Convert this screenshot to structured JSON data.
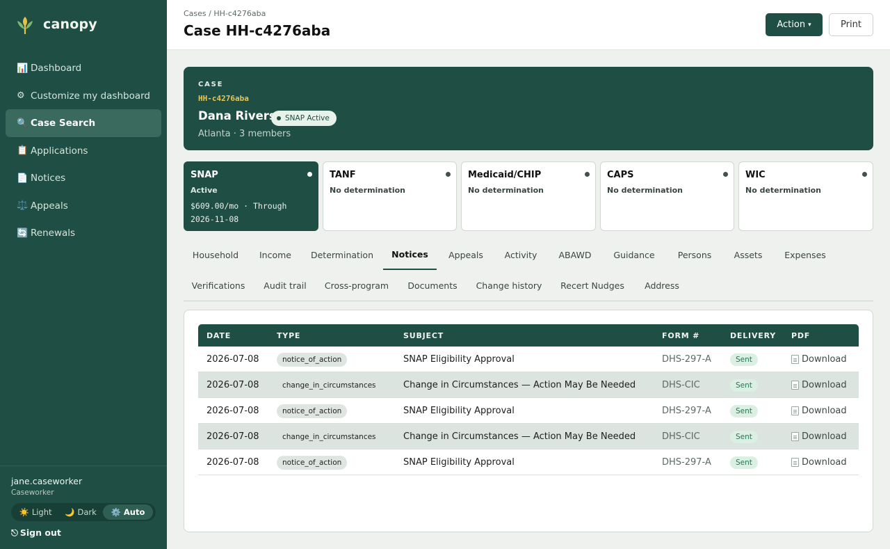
{
  "brand": {
    "name": "canopy"
  },
  "sidebar": {
    "items": [
      {
        "icon": "📊",
        "label": "Dashboard"
      },
      {
        "icon": "⚙",
        "label": "Customize my dashboard"
      },
      {
        "icon": "🔍",
        "label": "Case Search",
        "active": true
      },
      {
        "icon": "📋",
        "label": "Applications"
      },
      {
        "icon": "📄",
        "label": "Notices"
      },
      {
        "icon": "⚖️",
        "label": "Appeals"
      },
      {
        "icon": "🔄",
        "label": "Renewals"
      }
    ],
    "user": {
      "name": "jane.caseworker",
      "role": "Caseworker"
    },
    "theme": {
      "light": "Light",
      "dark": "Dark",
      "auto": "Auto",
      "light_icon": "☀️",
      "dark_icon": "🌙",
      "auto_icon": "⚙️"
    },
    "signout": "Sign out",
    "signout_icon": "⎋"
  },
  "header": {
    "breadcrumb": "Cases / HH-c4276aba",
    "title": "Case HH-c4276aba",
    "action_label": "Action",
    "action_caret": "▾",
    "print_label": "Print"
  },
  "case": {
    "eyebrow": "CASE",
    "id": "HH-c4276aba",
    "person": "Dana Rivers",
    "badge": "SNAP Active",
    "meta": "Atlanta · 3 members"
  },
  "programs": [
    {
      "name": "SNAP",
      "status": "Active",
      "amount": "$609.00/mo · Through 2026-11-08",
      "active": true
    },
    {
      "name": "TANF",
      "status": "No determination"
    },
    {
      "name": "Medicaid/CHIP",
      "status": "No determination"
    },
    {
      "name": "CAPS",
      "status": "No determination"
    },
    {
      "name": "WIC",
      "status": "No determination"
    }
  ],
  "tabs": [
    "Household",
    "Income",
    "Determination",
    "Notices",
    "Appeals",
    "Activity",
    "ABAWD",
    "Guidance",
    "Persons",
    "Assets",
    "Expenses",
    "Verifications",
    "Audit trail",
    "Cross-program",
    "Documents",
    "Change history",
    "Recert Nudges",
    "Address"
  ],
  "active_tab": "Notices",
  "notices": {
    "columns": [
      "DATE",
      "TYPE",
      "SUBJECT",
      "FORM #",
      "DELIVERY",
      "PDF"
    ],
    "rows": [
      {
        "date": "2026-07-08",
        "type": "notice_of_action",
        "subject": "SNAP Eligibility Approval",
        "form": "DHS-297-A",
        "delivery": "Sent",
        "pdf": "Download"
      },
      {
        "date": "2026-07-08",
        "type": "change_in_circumstances",
        "subject": "Change in Circumstances — Action May Be Needed",
        "form": "DHS-CIC",
        "delivery": "Sent",
        "pdf": "Download"
      },
      {
        "date": "2026-07-08",
        "type": "notice_of_action",
        "subject": "SNAP Eligibility Approval",
        "form": "DHS-297-A",
        "delivery": "Sent",
        "pdf": "Download"
      },
      {
        "date": "2026-07-08",
        "type": "change_in_circumstances",
        "subject": "Change in Circumstances — Action May Be Needed",
        "form": "DHS-CIC",
        "delivery": "Sent",
        "pdf": "Download"
      },
      {
        "date": "2026-07-08",
        "type": "notice_of_action",
        "subject": "SNAP Eligibility Approval",
        "form": "DHS-297-A",
        "delivery": "Sent",
        "pdf": "Download"
      }
    ]
  },
  "colors": {
    "brand_green": "#1f4f44",
    "accent_gold": "#e6c65a",
    "sent_green": "#26754f"
  }
}
